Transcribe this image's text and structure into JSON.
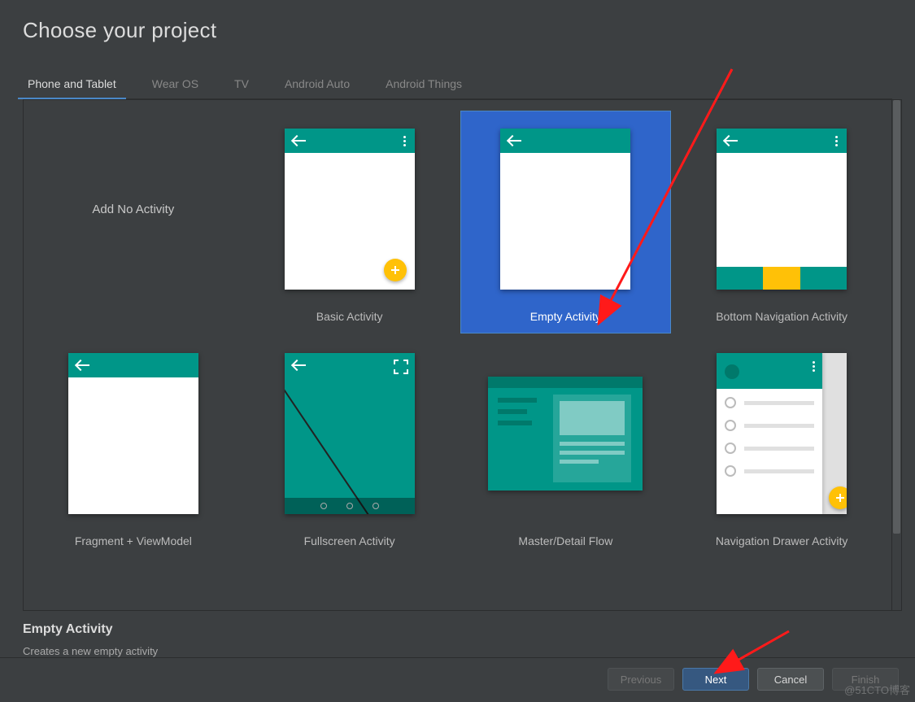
{
  "window": {
    "title": "Choose your project"
  },
  "tabs": [
    {
      "label": "Phone and Tablet",
      "active": true
    },
    {
      "label": "Wear OS"
    },
    {
      "label": "TV"
    },
    {
      "label": "Android Auto"
    },
    {
      "label": "Android Things"
    }
  ],
  "templates": [
    {
      "label": "Add No Activity",
      "kind": "none"
    },
    {
      "label": "Basic Activity",
      "kind": "basic"
    },
    {
      "label": "Empty Activity",
      "kind": "empty",
      "selected": true
    },
    {
      "label": "Bottom Navigation Activity",
      "kind": "bottomnav"
    },
    {
      "label": "Fragment + ViewModel",
      "kind": "fragment"
    },
    {
      "label": "Fullscreen Activity",
      "kind": "fullscreen"
    },
    {
      "label": "Master/Detail Flow",
      "kind": "masterdetail"
    },
    {
      "label": "Navigation Drawer Activity",
      "kind": "drawer"
    }
  ],
  "description": {
    "title": "Empty Activity",
    "text": "Creates a new empty activity"
  },
  "footer": {
    "previous": "Previous",
    "next": "Next",
    "cancel": "Cancel",
    "finish": "Finish"
  },
  "watermark": "@51CTO博客",
  "colors": {
    "teal": "#009688",
    "tealDark": "#00796b",
    "amber": "#ffc107",
    "selectBlue": "#2f65ca"
  }
}
